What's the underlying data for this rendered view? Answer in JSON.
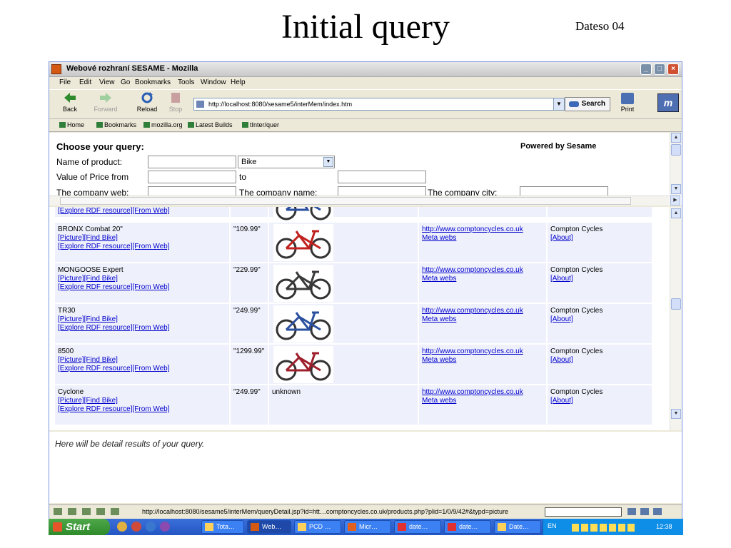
{
  "slide": {
    "title": "Initial query",
    "tag": "Dateso 04"
  },
  "window": {
    "title": "Webové rozhraní SESAME - Mozilla",
    "menu": [
      "File",
      "Edit",
      "View",
      "Go",
      "Bookmarks",
      "Tools",
      "Window",
      "Help"
    ],
    "toolbar": {
      "back": "Back",
      "forward": "Forward",
      "reload": "Reload",
      "stop": "Stop",
      "url": "http://localhost:8080/sesame5/interMem/index.htm",
      "search": "Search",
      "print": "Print",
      "brand": "m"
    },
    "bookmarks": [
      "Home",
      "Bookmarks",
      "mozilla.org",
      "Latest Builds",
      "tInter/quer"
    ]
  },
  "query": {
    "heading": "Choose your query:",
    "powered": "Powered by Sesame",
    "name_label": "Name of product:",
    "select_value": "Bike",
    "price_from_label": "Value of Price from",
    "to_label": "to",
    "web_label": "The company web:",
    "company_name_label": "The company name:",
    "company_city_label": "The company city:"
  },
  "results": {
    "top_partial_link": "[Explore RDF resource][From Web]",
    "rows": [
      {
        "name": "BRONX Combat 20\"",
        "links1": "[Picture][Find Bike]",
        "links2": "[Explore RDF resource][From Web]",
        "price": "\"109.99\"",
        "image": "bike",
        "image_color": "#c0221e",
        "url": "http://www.comptoncycles.co.uk",
        "meta": "Meta webs",
        "company": "Compton Cycles",
        "about": "[About]"
      },
      {
        "name": "MONGOOSE Expert",
        "links1": "[Picture][Find Bike]",
        "links2": "[Explore RDF resource][From Web]",
        "price": "\"229.99\"",
        "image": "bike",
        "image_color": "#3a3a3a",
        "url": "http://www.comptoncycles.co.uk",
        "meta": "Meta webs",
        "company": "Compton Cycles",
        "about": "[About]"
      },
      {
        "name": "TR30",
        "links1": "[Picture][Find Bike]",
        "links2": "[Explore RDF resource][From Web]",
        "price": "\"249.99\"",
        "image": "bike",
        "image_color": "#2a4f9e",
        "url": "http://www.comptoncycles.co.uk",
        "meta": "Meta webs",
        "company": "Compton Cycles",
        "about": "[About]"
      },
      {
        "name": "8500",
        "links1": "[Picture][Find Bike]",
        "links2": "[Explore RDF resource][From Web]",
        "price": "\"1299.99\"",
        "image": "bike",
        "image_color": "#9e1f2c",
        "url": "http://www.comptoncycles.co.uk",
        "meta": "Meta webs",
        "company": "Compton Cycles",
        "about": "[About]"
      },
      {
        "name": "Cyclone",
        "links1": "[Picture][Find Bike]",
        "links2": "[Explore RDF resource][From Web]",
        "price": "\"249.99\"",
        "image_text": "unknown",
        "url": "http://www.comptoncycles.co.uk",
        "meta": "Meta webs",
        "company": "Compton Cycles",
        "about": "[About]"
      }
    ]
  },
  "detail": {
    "text": "Here will be detail results of your query."
  },
  "status": {
    "url": "http://localhost:8080/sesame5/interMem/queryDetail.jsp?id=htt…comptoncycles.co.uk/products.php?plid=1/0/9/42#&typd=picture"
  },
  "taskbar": {
    "start": "Start",
    "tasks": [
      "Tota…",
      "Web…",
      "PCD …",
      "Micr…",
      "date…",
      "date…",
      "Date…"
    ],
    "lang": "EN",
    "clock": "12:38"
  }
}
